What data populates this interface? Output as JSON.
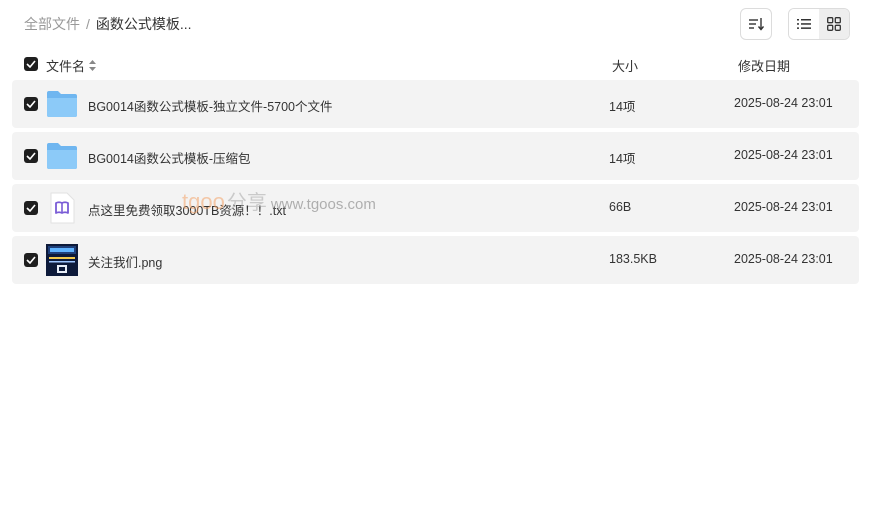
{
  "breadcrumb": {
    "root": "全部文件",
    "separator": "/",
    "current": "函数公式模板..."
  },
  "toolbar": {
    "sort_icon": "sort-lines-icon",
    "list_view_icon": "list-view-icon",
    "grid_view_icon": "grid-view-icon"
  },
  "columns": {
    "name": "文件名",
    "size": "大小",
    "date": "修改日期"
  },
  "files": [
    {
      "name": "BG0014函数公式模板-独立文件-5700个文件",
      "size": "14项",
      "date": "2025-08-24 23:01",
      "type": "folder"
    },
    {
      "name": "BG0014函数公式模板-压缩包",
      "size": "14项",
      "date": "2025-08-24 23:01",
      "type": "folder"
    },
    {
      "name": "点这里免费领取3000TB资源！！.txt",
      "size": "66B",
      "date": "2025-08-24 23:01",
      "type": "txt"
    },
    {
      "name": "关注我们.png",
      "size": "183.5KB",
      "date": "2025-08-24 23:01",
      "type": "image"
    }
  ],
  "watermark": {
    "brand": "tgoo",
    "cn": "分享",
    "url": "www.tgoos.com"
  },
  "colors": {
    "row_bg": "#f3f3f3",
    "checkbox": "#1f1f1f",
    "folder": "#7cc0f5",
    "txt_icon": "#7a5cd6"
  }
}
